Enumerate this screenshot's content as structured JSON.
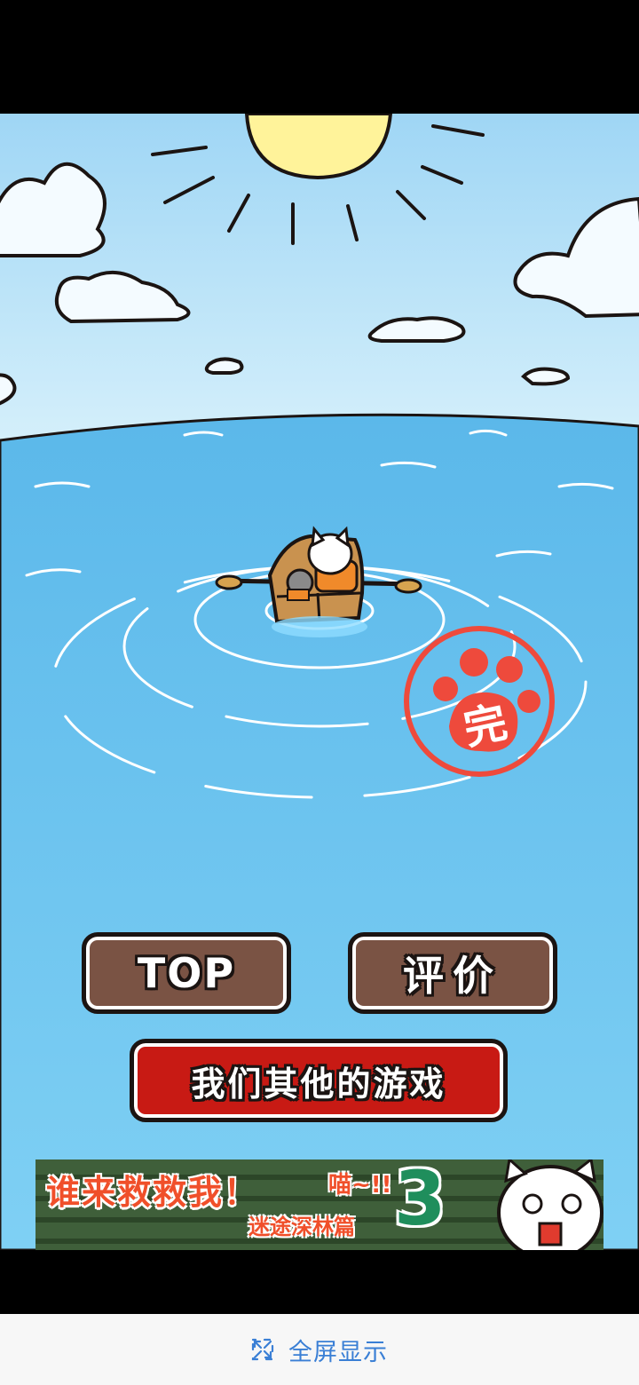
{
  "game": {
    "stamp_text": "完",
    "buttons": {
      "top_label": "TOP",
      "rate_label": "评价",
      "other_games_label": "我们其他的游戏"
    },
    "banner": {
      "title": "谁来救救我！",
      "meow": "喵~!!",
      "subtitle": "迷途深林篇",
      "number": "3"
    }
  },
  "footer": {
    "fullscreen_label": "全屏显示",
    "fullscreen_icon": "expand-icon"
  },
  "colors": {
    "sky": "#bfe4f8",
    "sea": "#6cc3ee",
    "sun": "#fff39a",
    "stamp": "#ee4a3c",
    "brown_button": "#7a5344",
    "red_button": "#c81a14",
    "fullscreen_text": "#3a7fd5"
  }
}
